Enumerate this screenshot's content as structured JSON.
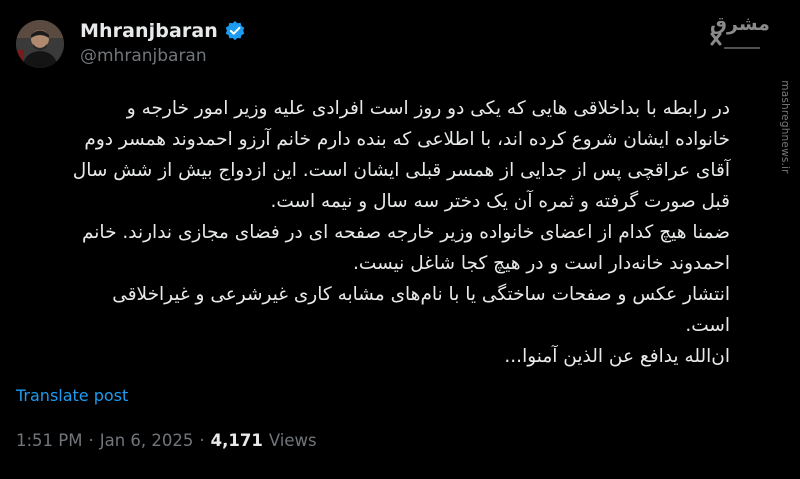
{
  "author": {
    "display_name": "Mhranjbaran",
    "handle": "@mhranjbaran",
    "verified": true
  },
  "watermark": {
    "logo_text": "مشرق",
    "site": "mashreghnews.ir"
  },
  "post": {
    "lines": [
      "در رابطه با بداخلاقی هایی که یکی دو روز است افرادی علیه وزیر امور خارجه و",
      "خانواده ایشان شروع کرده اند، با اطلاعی که بنده دارم خانم آرزو احمدوند همسر دوم",
      "آقای عراقچی پس از جدایی از همسر قبلی ایشان است. این ازدواج بیش از شش سال",
      "قبل صورت گرفته و ثمره آن یک دختر سه سال و نیمه است.",
      "ضمنا هیچ کدام از اعضای خانواده وزیر خارجه صفحه ای در فضای مجازی ندارند. خانم",
      "احمدوند خانه‌دار است و در هیچ کجا شاغل نیست.",
      "انتشار عکس و صفحات ساختگی یا با نام‌های مشابه کاری غیرشرعی و غیراخلاقی",
      "است.",
      "ان‌الله یدافع عن الذین آمنوا..."
    ],
    "translate_label": "Translate post"
  },
  "meta": {
    "time": "1:51 PM",
    "separator": "·",
    "date": "Jan 6, 2025",
    "views_count": "4,171",
    "views_label": "Views"
  },
  "colors": {
    "background": "#000000",
    "text": "#e7e9ea",
    "muted": "#71767b",
    "link": "#1d9bf0",
    "verified": "#1d9bf0"
  },
  "icons": {
    "verified": "verified-badge-icon"
  }
}
